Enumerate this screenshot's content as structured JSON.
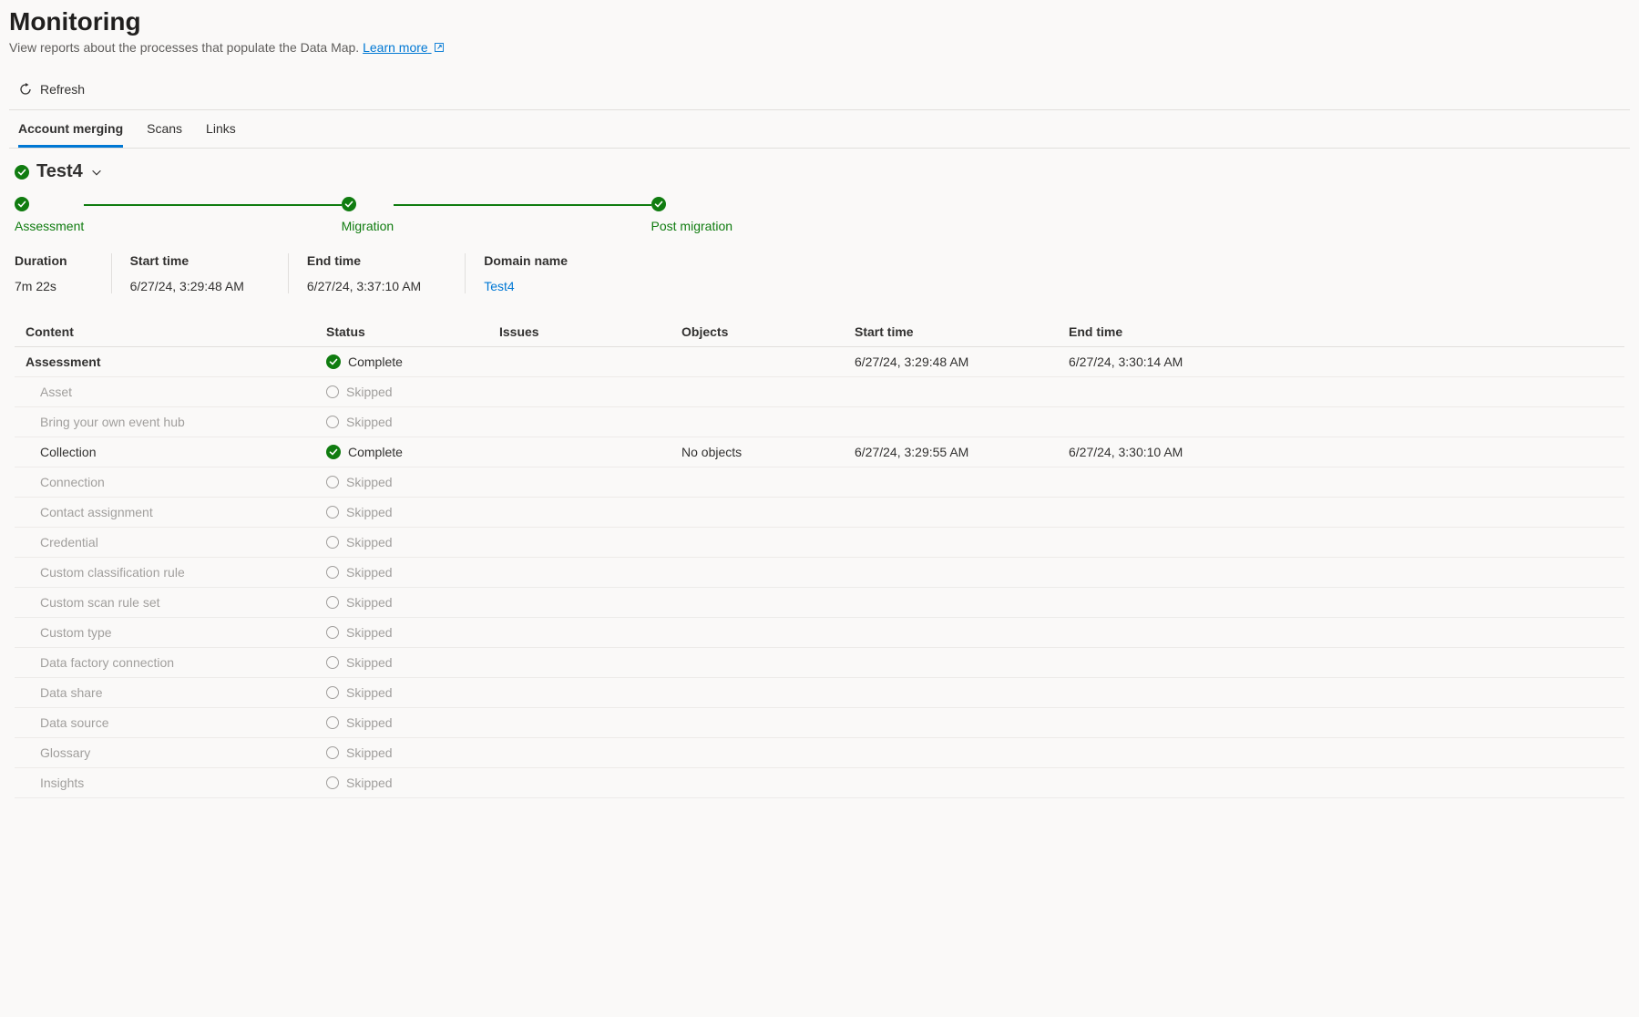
{
  "header": {
    "title": "Monitoring",
    "subtitle_prefix": "View reports about the processes that populate the Data Map. ",
    "learn_more": "Learn more",
    "refresh_label": "Refresh"
  },
  "tabs": [
    "Account merging",
    "Scans",
    "Links"
  ],
  "active_tab": 0,
  "domain": {
    "name": "Test4"
  },
  "steps": [
    "Assessment",
    "Migration",
    "Post migration"
  ],
  "meta": {
    "duration_label": "Duration",
    "duration_value": "7m 22s",
    "start_label": "Start time",
    "start_value": "6/27/24, 3:29:48 AM",
    "end_label": "End time",
    "end_value": "6/27/24, 3:37:10 AM",
    "domain_label": "Domain name",
    "domain_value": "Test4"
  },
  "columns": {
    "content": "Content",
    "status": "Status",
    "issues": "Issues",
    "objects": "Objects",
    "start": "Start time",
    "end": "End time"
  },
  "status_labels": {
    "complete": "Complete",
    "skipped": "Skipped"
  },
  "rows": [
    {
      "content": "Assessment",
      "status": "complete",
      "issues": "",
      "objects": "",
      "start": "6/27/24, 3:29:48 AM",
      "end": "6/27/24, 3:30:14 AM",
      "kind": "section"
    },
    {
      "content": "Asset",
      "status": "skipped",
      "kind": "skipped"
    },
    {
      "content": "Bring your own event hub",
      "status": "skipped",
      "kind": "skipped"
    },
    {
      "content": "Collection",
      "status": "complete",
      "issues": "",
      "objects": "No objects",
      "start": "6/27/24, 3:29:55 AM",
      "end": "6/27/24, 3:30:10 AM",
      "kind": "complete-sub"
    },
    {
      "content": "Connection",
      "status": "skipped",
      "kind": "skipped"
    },
    {
      "content": "Contact assignment",
      "status": "skipped",
      "kind": "skipped"
    },
    {
      "content": "Credential",
      "status": "skipped",
      "kind": "skipped"
    },
    {
      "content": "Custom classification rule",
      "status": "skipped",
      "kind": "skipped"
    },
    {
      "content": "Custom scan rule set",
      "status": "skipped",
      "kind": "skipped"
    },
    {
      "content": "Custom type",
      "status": "skipped",
      "kind": "skipped"
    },
    {
      "content": "Data factory connection",
      "status": "skipped",
      "kind": "skipped"
    },
    {
      "content": "Data share",
      "status": "skipped",
      "kind": "skipped"
    },
    {
      "content": "Data source",
      "status": "skipped",
      "kind": "skipped"
    },
    {
      "content": "Glossary",
      "status": "skipped",
      "kind": "skipped"
    },
    {
      "content": "Insights",
      "status": "skipped",
      "kind": "skipped"
    }
  ]
}
